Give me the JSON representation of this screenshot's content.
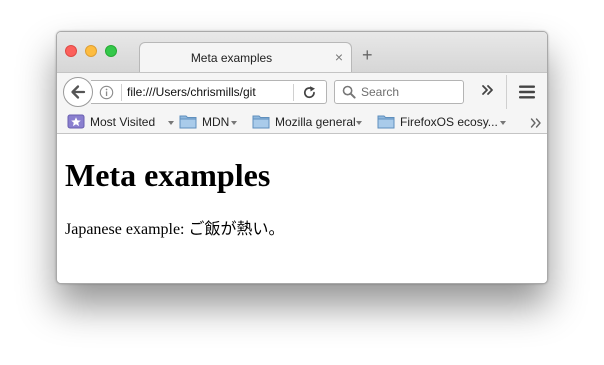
{
  "browser": {
    "tab": {
      "title": "Meta examples",
      "close_glyph": "×"
    },
    "new_tab_glyph": "+",
    "navbar": {
      "url": "file:///Users/chrismills/git",
      "search_placeholder": "Search"
    },
    "bookmarks": [
      {
        "label": "Most Visited",
        "icon": "star-folder-icon"
      },
      {
        "label": "MDN",
        "icon": "folder-icon"
      },
      {
        "label": "Mozilla general",
        "icon": "folder-icon"
      },
      {
        "label": "FirefoxOS ecosy...",
        "icon": "folder-icon"
      }
    ]
  },
  "page": {
    "heading": "Meta examples",
    "paragraph": "Japanese example: ご飯が熱い。"
  },
  "colors": {
    "traffic_close": "#fc605c",
    "traffic_minimize": "#fdbc40",
    "traffic_maximize": "#34c84a",
    "folder_blue": "#8fb8de"
  }
}
